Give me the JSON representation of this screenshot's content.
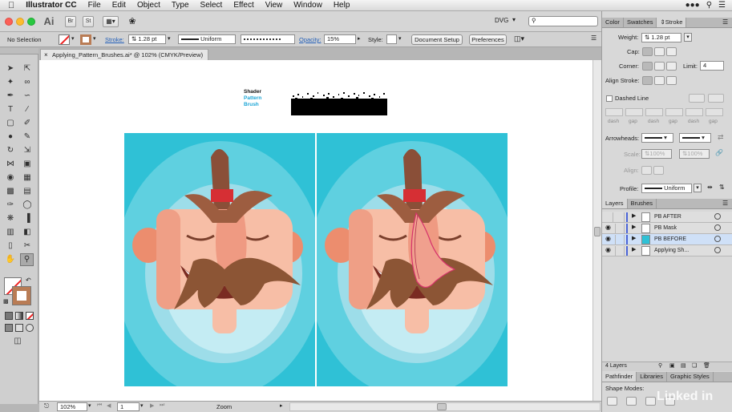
{
  "menubar": {
    "apple": "",
    "app_name": "Illustrator CC",
    "items": [
      "File",
      "Edit",
      "Object",
      "Type",
      "Select",
      "Effect",
      "View",
      "Window",
      "Help"
    ]
  },
  "appbar": {
    "logo": "Ai",
    "workspace": "DVG"
  },
  "control_bar": {
    "selection_label": "No Selection",
    "stroke_label": "Stroke:",
    "stroke_value": "1.28 pt",
    "profile_label": "Uniform",
    "opacity_label": "Opacity:",
    "opacity_value": "15%",
    "style_label": "Style:",
    "document_setup": "Document Setup",
    "preferences": "Preferences"
  },
  "document_tab": {
    "title": "Applying_Pattern_Brushes.ai* @ 102% (CMYK/Preview)"
  },
  "canvas": {
    "label_line1": "Shader",
    "label_line2": "Pattern",
    "label_line3": "Brush"
  },
  "statusbar": {
    "zoom_value": "102%",
    "artboard_value": "1",
    "status_text": "Zoom"
  },
  "stroke_panel": {
    "tabs": [
      "Color",
      "Swatches",
      "Stroke"
    ],
    "weight_label": "Weight:",
    "weight_value": "1.28 pt",
    "cap_label": "Cap:",
    "corner_label": "Corner:",
    "limit_label": "Limit:",
    "limit_value": "4",
    "align_label": "Align Stroke:",
    "dashed_label": "Dashed Line",
    "dash_labels": [
      "dash",
      "gap",
      "dash",
      "gap",
      "dash",
      "gap"
    ],
    "arrowheads_label": "Arrowheads:",
    "scale_label": "Scale:",
    "scale_value1": "100%",
    "scale_value2": "100%",
    "align2_label": "Align:",
    "profile_label": "Profile:",
    "profile_value": "Uniform"
  },
  "layers_panel": {
    "tabs": [
      "Layers",
      "Brushes"
    ],
    "layers": [
      {
        "name": "PB AFTER",
        "visible": false,
        "selected": false
      },
      {
        "name": "PB Mask",
        "visible": true,
        "selected": false
      },
      {
        "name": "PB BEFORE",
        "visible": true,
        "selected": true
      },
      {
        "name": "Applying Sh...",
        "visible": true,
        "selected": false
      }
    ],
    "count": "4 Layers"
  },
  "bottom_panel": {
    "tabs": [
      "Pathfinder",
      "Libraries",
      "Graphic Styles"
    ],
    "shape_modes_label": "Shape Modes:"
  },
  "watermark": "Linked in",
  "colors": {
    "artboard_bg": "#2fc1d6",
    "hat": "#8a4f38",
    "hat_band": "#d62f34",
    "skin": "#f5b8a0",
    "mustache": "#8c5535",
    "selection_path": "#d6336c"
  }
}
